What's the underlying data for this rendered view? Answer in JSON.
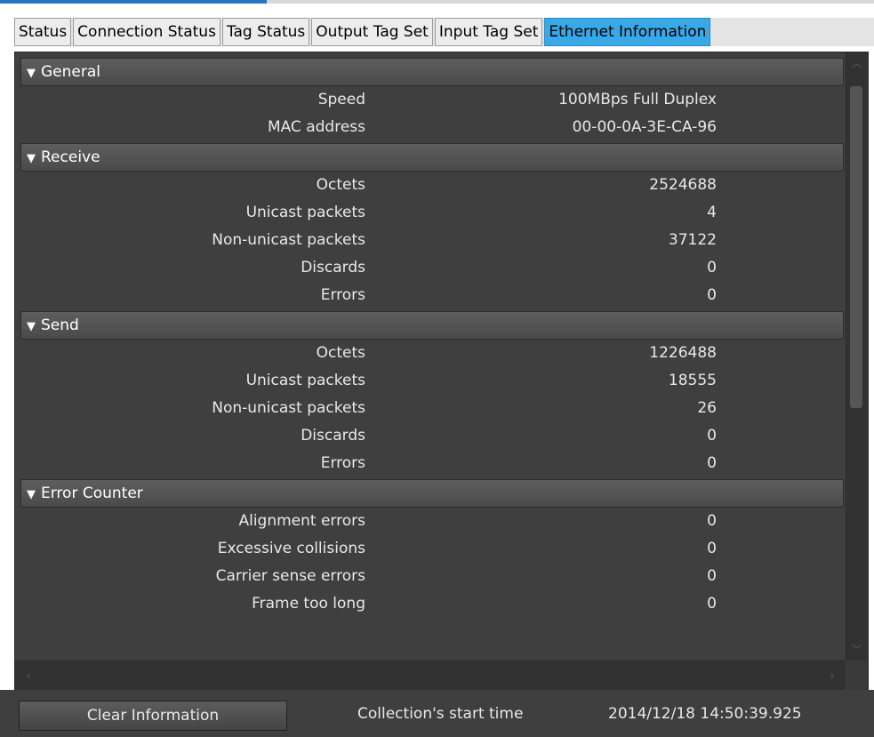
{
  "tabs": [
    {
      "label": "Status"
    },
    {
      "label": "Connection Status"
    },
    {
      "label": "Tag Status"
    },
    {
      "label": "Output Tag Set"
    },
    {
      "label": "Input Tag Set"
    },
    {
      "label": "Ethernet Information"
    }
  ],
  "sections": {
    "general": {
      "title": "General",
      "rows": [
        {
          "label": "Speed",
          "value": "100MBps Full Duplex"
        },
        {
          "label": "MAC address",
          "value": "00-00-0A-3E-CA-96"
        }
      ]
    },
    "receive": {
      "title": "Receive",
      "rows": [
        {
          "label": "Octets",
          "value": "2524688"
        },
        {
          "label": "Unicast packets",
          "value": "4"
        },
        {
          "label": "Non-unicast packets",
          "value": "37122"
        },
        {
          "label": "Discards",
          "value": "0"
        },
        {
          "label": "Errors",
          "value": "0"
        }
      ]
    },
    "send": {
      "title": "Send",
      "rows": [
        {
          "label": "Octets",
          "value": "1226488"
        },
        {
          "label": "Unicast packets",
          "value": "18555"
        },
        {
          "label": "Non-unicast packets",
          "value": "26"
        },
        {
          "label": "Discards",
          "value": "0"
        },
        {
          "label": "Errors",
          "value": "0"
        }
      ]
    },
    "error_counter": {
      "title": "Error Counter",
      "rows": [
        {
          "label": "Alignment errors",
          "value": "0"
        },
        {
          "label": "Excessive collisions",
          "value": "0"
        },
        {
          "label": "Carrier sense errors",
          "value": "0"
        },
        {
          "label": "Frame too long",
          "value": "0"
        }
      ]
    }
  },
  "footer": {
    "clear_button": "Clear Information",
    "start_label": "Collection's start time",
    "start_value": "2014/12/18 14:50:39.925"
  },
  "icons": {
    "expand": "triangle-down-icon",
    "scroll_up": "chevron-up-icon",
    "scroll_down": "chevron-down-icon",
    "scroll_left": "chevron-left-icon",
    "scroll_right": "chevron-right-icon"
  },
  "colors": {
    "panel_bg": "#3f3f3f",
    "active_tab": "#39a8e6",
    "text": "#e8e8e8"
  }
}
